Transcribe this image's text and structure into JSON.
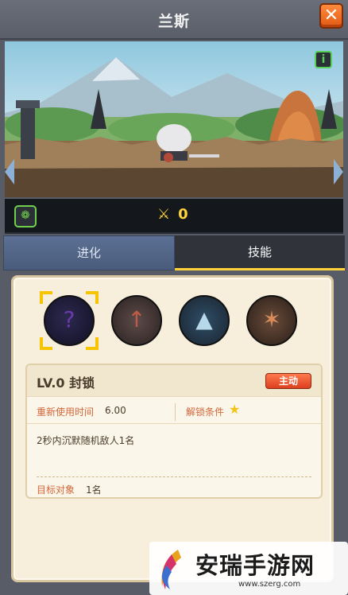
{
  "header": {
    "title": "兰斯",
    "close_icon": "close-x-icon"
  },
  "scene": {
    "info_icon": "info-icon"
  },
  "stats": {
    "power_icon": "crossed-swords-icon",
    "power_value": "0",
    "pet_icon": "paw-icon"
  },
  "tabs": [
    {
      "label": "进化",
      "active": false
    },
    {
      "label": "技能",
      "active": true
    }
  ],
  "skill_slots": [
    {
      "name": "skill-seal",
      "selected": true
    },
    {
      "name": "skill-2",
      "selected": false
    },
    {
      "name": "skill-3",
      "selected": false
    },
    {
      "name": "skill-4",
      "selected": false
    }
  ],
  "skill_detail": {
    "level": "LV.0",
    "name": "封锁",
    "type_badge": "主动",
    "cooldown_label": "重新使用时间",
    "cooldown_value": "6.00",
    "unlock_label": "解锁条件",
    "description": "2秒内沉默随机敌人1名",
    "target_label": "目标对象",
    "target_value": "1名"
  },
  "watermark": {
    "title": "安瑞手游网",
    "url": "www.szerg.com"
  },
  "colors": {
    "accent": "#ffd23a",
    "badge": "#dc3f1f",
    "label": "#d2673a"
  }
}
